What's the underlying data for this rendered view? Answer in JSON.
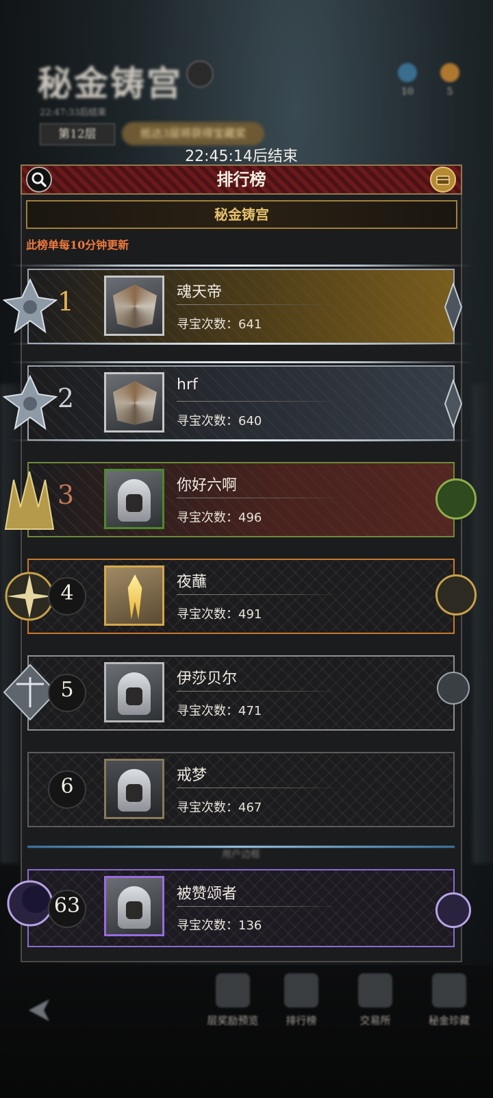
{
  "background": {
    "title": "秘金铸宫",
    "subtitle": "22:47:33后结束",
    "floor": "第12层",
    "banner": "抵达3层将获得宝藏奖",
    "resources": [
      {
        "value": "10"
      },
      {
        "value": "5"
      }
    ]
  },
  "timer": "22:45:14后结束",
  "panel": {
    "title": "排行榜",
    "tab": "秘金铸宫",
    "notice": "此榜单每10分钟更新"
  },
  "count_label": "寻宝次数：",
  "rows": [
    {
      "rank": "1",
      "name": "魂天帝",
      "count": "641"
    },
    {
      "rank": "2",
      "name": "hrf",
      "count": "640"
    },
    {
      "rank": "3",
      "name": "你好六啊",
      "count": "496"
    },
    {
      "rank": "4",
      "name": "夜蘸",
      "count": "491"
    },
    {
      "rank": "5",
      "name": "伊莎贝尔",
      "count": "471"
    },
    {
      "rank": "6",
      "name": "戒梦",
      "count": "467"
    }
  ],
  "divider_text": "用户边框",
  "self_row": {
    "rank": "63",
    "name": "被赞颂者",
    "count": "136"
  },
  "bottom_nav": [
    {
      "label": "层奖励预览"
    },
    {
      "label": "排行榜"
    },
    {
      "label": "交易所"
    },
    {
      "label": "秘金珍藏"
    }
  ],
  "colors": {
    "accent_red": "#6a1a1d",
    "gold": "#e8c26d",
    "notice_orange": "#f07a3c",
    "self_purple": "#8a6bd0"
  }
}
